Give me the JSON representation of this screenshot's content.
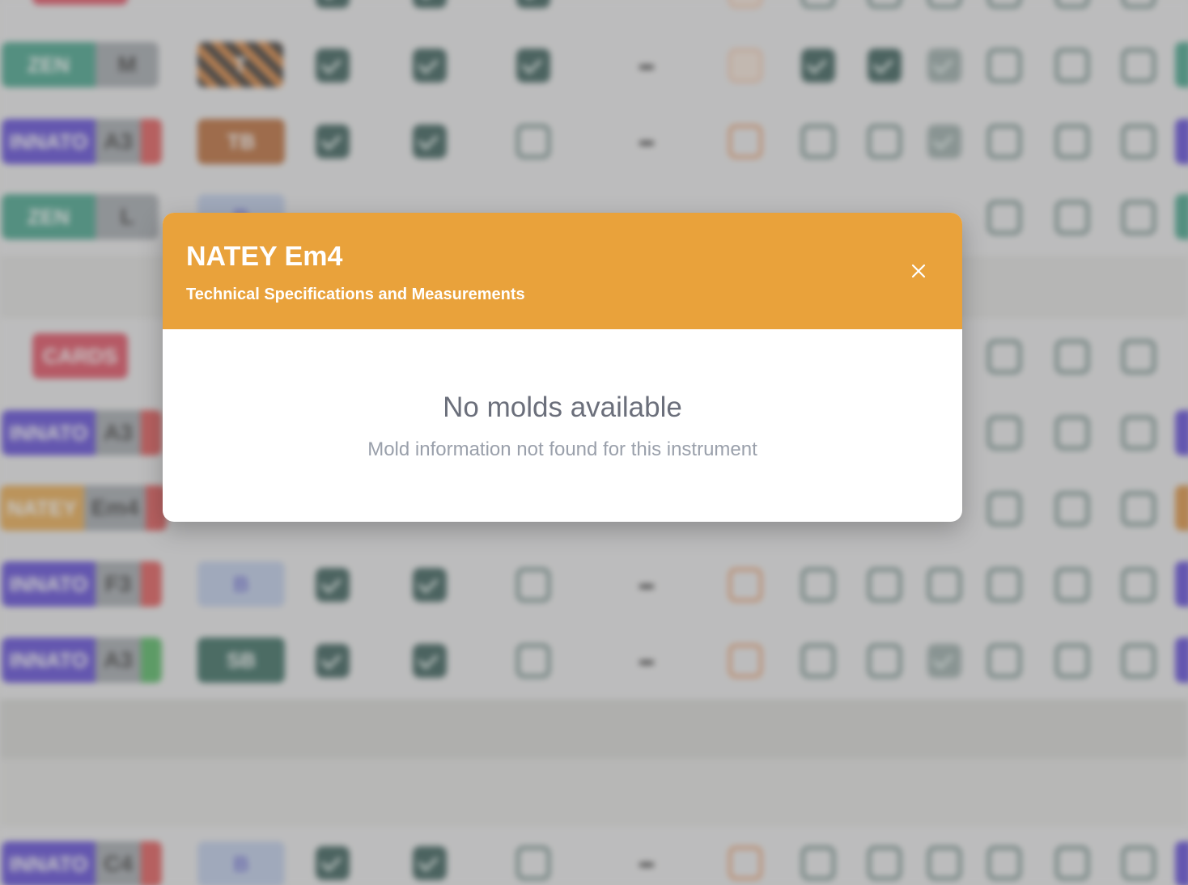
{
  "modal": {
    "title": "NATEY Em4",
    "subtitle": "Technical Specifications and Measurements",
    "close_icon": "close-icon",
    "empty_state": {
      "title": "No molds available",
      "description": "Mold information not found for this instrument"
    }
  },
  "background_table": {
    "colors": {
      "zen": "#2e9a7e",
      "innato": "#4b33d4",
      "natey": "#e9a23b",
      "cards": "#e0394e",
      "size": "#9aa0a6",
      "tip_red": "#e04444",
      "tip_green": "#3fb04f",
      "checked": "#1f4a44",
      "unchecked_border": "#4b716b",
      "orange_border": "#e8925c"
    },
    "rows": [
      {
        "brand": "ZEN",
        "size": "M",
        "type": "T"
      },
      {
        "brand": "INNATO",
        "size": "A3",
        "type": "TB"
      },
      {
        "brand": "ZEN",
        "size": "L",
        "type": "B"
      },
      {
        "brand": "CARDS"
      },
      {
        "brand": "INNATO",
        "size": "A3",
        "type": ""
      },
      {
        "brand": "NATEY",
        "size": "Em4",
        "type": ""
      },
      {
        "brand": "INNATO",
        "size": "F3",
        "type": "B"
      },
      {
        "brand": "INNATO",
        "size": "A3",
        "type": "SB"
      },
      {
        "brand": "INNATO",
        "size": "C4",
        "type": "B"
      }
    ]
  }
}
